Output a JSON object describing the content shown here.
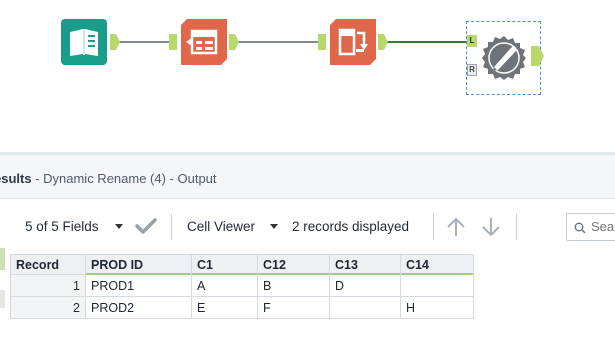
{
  "canvas": {
    "tools": [
      {
        "name": "input-data-tool",
        "icon": "book-icon",
        "color": "#1a9c8a"
      },
      {
        "name": "select-records-tool",
        "icon": "select-records-icon",
        "color": "#e0674a"
      },
      {
        "name": "dynamic-rename-tool",
        "icon": "dynamic-rename-icon",
        "color": "#e0674a"
      },
      {
        "name": "render-tool",
        "icon": "gear-pen-icon",
        "color": "#6d7379"
      }
    ],
    "anchor_color": "#b7d86a",
    "connection_color": "#2e7d3a",
    "render_anchor_l": "L",
    "render_anchor_r": "R"
  },
  "results": {
    "title_bold": "esults",
    "title_rest": " - Dynamic Rename (4) - Output"
  },
  "toolbar": {
    "fields_label": "5 of 5 Fields",
    "viewer_label": "Cell Viewer",
    "records_label": "2 records displayed",
    "search_placeholder": "Sea"
  },
  "table": {
    "columns": [
      "Record",
      "PROD ID",
      "C1",
      "C12",
      "C13",
      "C14"
    ],
    "rows": [
      [
        "1",
        "PROD1",
        "A",
        "B",
        "D",
        ""
      ],
      [
        "2",
        "PROD2",
        "E",
        "F",
        "",
        "H"
      ]
    ]
  }
}
